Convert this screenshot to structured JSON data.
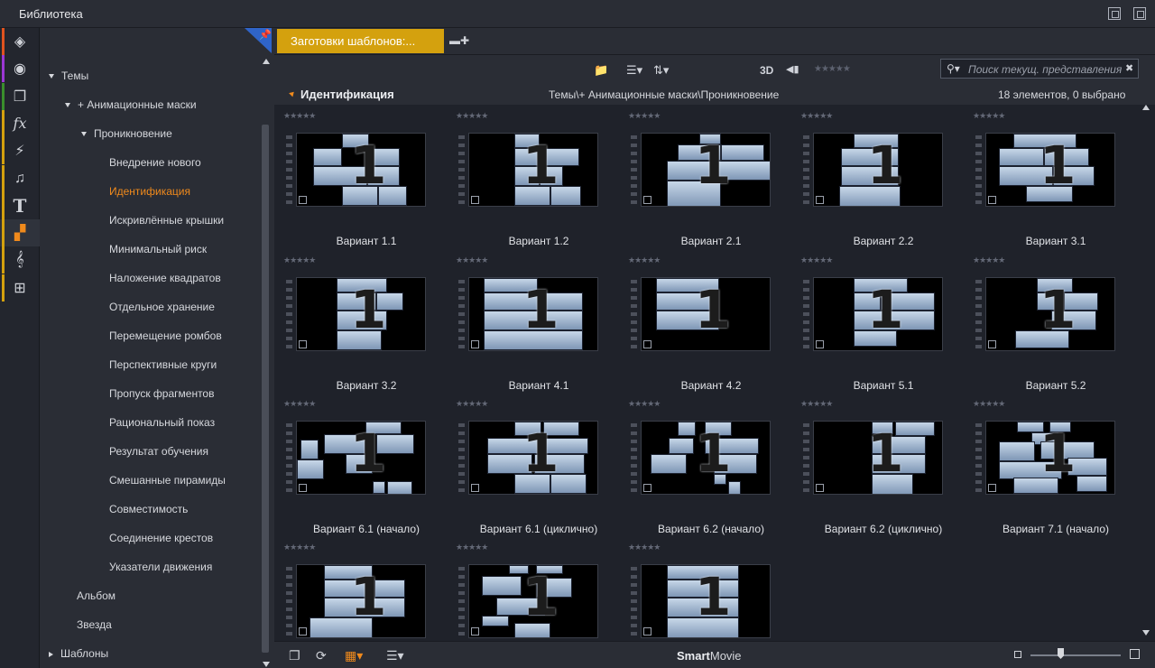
{
  "window": {
    "title": "Библиотека"
  },
  "strip": [
    {
      "name": "project-bin-icon",
      "glyph": "◈",
      "color": "#e0531f"
    },
    {
      "name": "film-reel-icon",
      "glyph": "◉",
      "color": "#9b37d4"
    },
    {
      "name": "photos-icon",
      "glyph": "❐",
      "color": "#3a8f2c"
    },
    {
      "name": "effects-fx-icon",
      "glyph": "fx",
      "color": "#d4a10e"
    },
    {
      "name": "transition-bolt-icon",
      "glyph": "⚡",
      "color": "#d4a10e"
    },
    {
      "name": "music-note-icon",
      "glyph": "♫",
      "color": "#d4a10e"
    },
    {
      "name": "title-t-icon",
      "glyph": "T",
      "color": "#d4a10e"
    },
    {
      "name": "montage-themes-icon",
      "glyph": "▞",
      "color": "#d4a10e"
    },
    {
      "name": "treble-clef-icon",
      "glyph": "𝄞",
      "color": "#d4a10e"
    },
    {
      "name": "piano-icon",
      "glyph": "⊞",
      "color": "#d4a10e"
    }
  ],
  "tree": [
    {
      "label": "Темы",
      "indent": 0,
      "arrow": "down"
    },
    {
      "label": "+ Анимационные маски",
      "indent": 1,
      "arrow": "down"
    },
    {
      "label": "Проникновение",
      "indent": 2,
      "arrow": "down"
    },
    {
      "label": "Внедрение нового",
      "indent": 3,
      "arrow": ""
    },
    {
      "label": "Идентификация",
      "indent": 3,
      "arrow": "",
      "selected": true
    },
    {
      "label": "Искривлённые крышки",
      "indent": 3,
      "arrow": ""
    },
    {
      "label": "Минимальный риск",
      "indent": 3,
      "arrow": ""
    },
    {
      "label": "Наложение квадратов",
      "indent": 3,
      "arrow": ""
    },
    {
      "label": "Отдельное хранение",
      "indent": 3,
      "arrow": ""
    },
    {
      "label": "Перемещение ромбов",
      "indent": 3,
      "arrow": ""
    },
    {
      "label": "Перспективные круги",
      "indent": 3,
      "arrow": ""
    },
    {
      "label": "Пропуск фрагментов",
      "indent": 3,
      "arrow": ""
    },
    {
      "label": "Рациональный показ",
      "indent": 3,
      "arrow": ""
    },
    {
      "label": "Результат обучения",
      "indent": 3,
      "arrow": ""
    },
    {
      "label": "Смешанные пирамиды",
      "indent": 3,
      "arrow": ""
    },
    {
      "label": "Совместимость",
      "indent": 3,
      "arrow": ""
    },
    {
      "label": "Соединение крестов",
      "indent": 3,
      "arrow": ""
    },
    {
      "label": "Указатели движения",
      "indent": 3,
      "arrow": ""
    },
    {
      "label": "Альбом",
      "indent": 1,
      "arrow": ""
    },
    {
      "label": "Звезда",
      "indent": 1,
      "arrow": ""
    },
    {
      "label": "Шаблоны",
      "indent": 0,
      "arrow": "right"
    }
  ],
  "tab": {
    "label": "Заготовки шаблонов:..."
  },
  "toolbar": {
    "btn_3d": "3D",
    "stars": "★★★★★",
    "search_placeholder": "Поиск текущ. представления"
  },
  "breadcrumb": {
    "title": "Идентификация",
    "path": "Темы\\+ Анимационные маски\\Проникновение",
    "count": "18 элементов, 0 выбрано"
  },
  "rating_stars": "★★★★★",
  "thumb_number": "1",
  "items": [
    {
      "label": "Вариант 1.1"
    },
    {
      "label": "Вариант 1.2"
    },
    {
      "label": "Вариант 2.1"
    },
    {
      "label": "Вариант 2.2"
    },
    {
      "label": "Вариант 3.1"
    },
    {
      "label": "Вариант 3.2"
    },
    {
      "label": "Вариант 4.1"
    },
    {
      "label": "Вариант 4.2"
    },
    {
      "label": "Вариант 5.1"
    },
    {
      "label": "Вариант 5.2"
    },
    {
      "label": "Вариант 6.1 (начало)"
    },
    {
      "label": "Вариант 6.1 (циклично)"
    },
    {
      "label": "Вариант 6.2 (начало)"
    },
    {
      "label": "Вариант 6.2 (циклично)"
    },
    {
      "label": "Вариант 7.1 (начало)"
    },
    {
      "label": ""
    },
    {
      "label": ""
    },
    {
      "label": ""
    }
  ],
  "bottom": {
    "brand_bold": "Smart",
    "brand_rest": "Movie"
  },
  "zoom": {
    "level": 0.33
  }
}
